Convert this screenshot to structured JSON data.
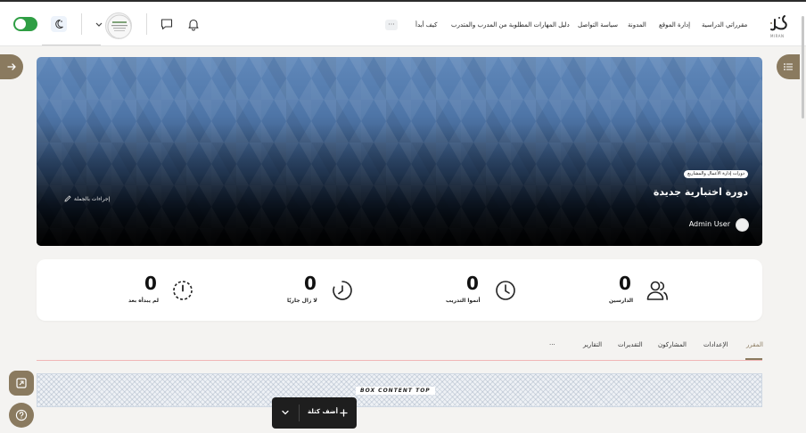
{
  "header": {
    "logo_text": "ميران",
    "logo_sub": "MIRAN",
    "nav_links": [
      "مقرراتي الدراسية",
      "إدارة الموقع",
      "المدونة",
      "سياسة التواصل",
      "دليل المهارات المطلوبة من المدرب والمتدرب",
      "كيف أبدأ"
    ],
    "more_label": "···"
  },
  "hero": {
    "category_badge": "دورات إدارة الأعمال والمشاريع",
    "course_title": "دورة اختبارية جديدة",
    "bulk_actions_label": "إجراءات بالجملة",
    "user_name": "Admin User"
  },
  "stats": [
    {
      "icon": "users-icon",
      "value": "0",
      "label": "الدارسين"
    },
    {
      "icon": "clock-icon",
      "value": "0",
      "label": "أتموا التدريب"
    },
    {
      "icon": "progress-clock-icon",
      "value": "0",
      "label": "لا زال جاريًا"
    },
    {
      "icon": "not-started-icon",
      "value": "0",
      "label": "لم يبدأه بعد"
    }
  ],
  "tabs": [
    {
      "label": "المقرر",
      "active": true
    },
    {
      "label": "الإعدادات",
      "active": false
    },
    {
      "label": "المشاركون",
      "active": false
    },
    {
      "label": "التقديرات",
      "active": false
    },
    {
      "label": "التقارير",
      "active": false
    },
    {
      "label": "···",
      "active": false
    }
  ],
  "box_content": {
    "label": "BOX CONTENT TOP"
  },
  "add_block": {
    "label": "أضف كتلة"
  },
  "colors": {
    "accent": "#8a7a5f",
    "toggle_on": "#2f9e44",
    "tab_line": "#f0b6b6",
    "hero_top": "#6088ba",
    "dark_button": "#1e1e1e"
  }
}
